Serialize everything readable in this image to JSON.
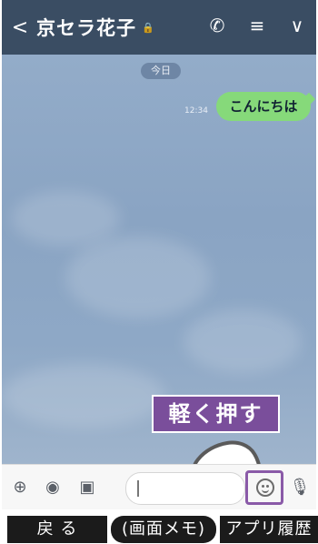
{
  "header": {
    "back_glyph": "<",
    "contact_name": "京セラ花子",
    "lock_glyph": "🔒",
    "call_glyph": "✆",
    "menu_glyph": "≡",
    "dropdown_glyph": "∨"
  },
  "chat": {
    "date_label": "今日",
    "messages": [
      {
        "time": "12:34",
        "text": "こんにちは",
        "sender": "me"
      }
    ]
  },
  "callout": {
    "text": "軽く押す"
  },
  "input_bar": {
    "add_glyph": "⊕",
    "camera_glyph": "◉",
    "image_glyph": "▣",
    "mic_glyph": "🎙"
  },
  "bottom_buttons": [
    {
      "label": "戻 る"
    },
    {
      "label": "(画面メモ)"
    },
    {
      "label": "アプリ履歴"
    }
  ],
  "colors": {
    "header_bg": "#3a4d63",
    "chat_bg": "#8fa9c9",
    "bubble_green": "#86d97a",
    "callout_purple": "#7a4e9b"
  }
}
